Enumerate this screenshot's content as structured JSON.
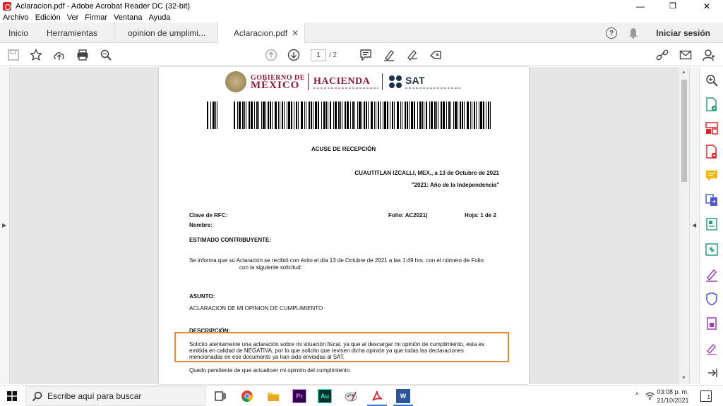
{
  "window": {
    "title": "Aclaracion.pdf - Adobe Acrobat Reader DC (32-bit)",
    "minimize": "—",
    "maximize": "❐",
    "close": "✕"
  },
  "menu": [
    "Archivo",
    "Edición",
    "Ver",
    "Firmar",
    "Ventana",
    "Ayuda"
  ],
  "tabs": {
    "home": "Inicio",
    "tools": "Herramientas",
    "doc1": "opinion de umplimi...",
    "doc2": "Aclaracion.pdf",
    "close_glyph": "✕",
    "help_glyph": "?",
    "signin": "Iniciar sesión"
  },
  "toolbar": {
    "page_current": "1",
    "page_total": "/ 2"
  },
  "document": {
    "gob_line1": "GOBIERNO DE",
    "gob_line2": "MÉXICO",
    "hacienda": "HACIENDA",
    "sat": "SAT",
    "heading": "ACUSE DE RECEPCIÓN",
    "place_date": "CUAUTITLAN IZCALLI, MEX., a  13 de Octubre de 2021",
    "year_motto": "\"2021: Año de la Independencia\"",
    "rfc_label": "Clave de RFC:",
    "name_label": "Nombre:",
    "folio": "Folio: AC2021(",
    "sheet": "Hoja: 1 de 2",
    "salutation": "ESTIMADO CONTRIBUYENTE:",
    "info_line1": "Se informa que su Aclaración se recibió con éxito el día 13 de Octubre de 2021 a las 1:49 hrs. con el número de Folio:",
    "info_line2": "con la siguiente solicitud:",
    "subject_label": "ASUNTO:",
    "subject": "ACLARACION DE MI OPINION DE CUMPLIMIENTO",
    "desc_label": "DESCRIPCIÓN:",
    "desc_line1": "Solicito atentamente una aclaración sobre mi situación fiscal, ya que al descargar mi opinión de cumplimiento, esta es",
    "desc_line2": "emitida en calidad de NEGATIVA, por lo que solicito que revisen dicha opinión ya que todas las declaraciones",
    "desc_line3": "mencionadas en ese documento ya han sido enviadas al SAT.",
    "closing": "Quedo pendiente de que actualicen mi opinión del cumplimiento"
  },
  "taskbar": {
    "search_placeholder": "Escribe aquí para buscar",
    "time": "03:08 p. m.",
    "date": "21/10/2021",
    "premiere": "Pr",
    "audition": "Au",
    "word": "W",
    "notify": "1"
  },
  "colors": {
    "acrobat_red": "#d8262d",
    "gob_maroon": "#8b1c3b",
    "sat_navy": "#1e2e4f",
    "highlight_orange": "#e8893a"
  }
}
